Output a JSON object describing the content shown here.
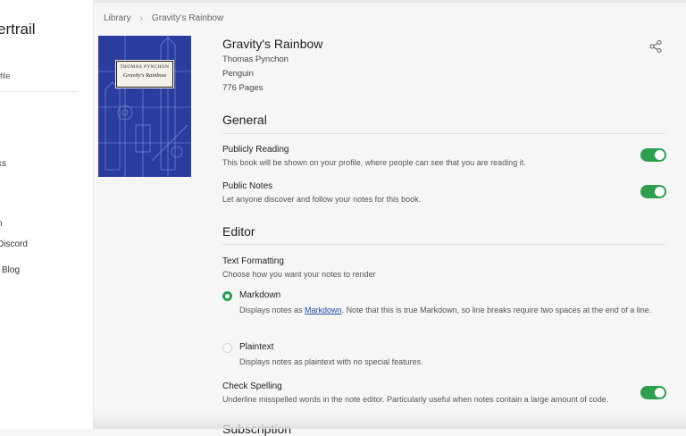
{
  "sidebar": {
    "brand": "ertrail",
    "profile": "file",
    "items": [
      {
        "label": "ks"
      },
      {
        "label": "n"
      },
      {
        "label": "Discord"
      },
      {
        "label": "l Blog"
      }
    ]
  },
  "breadcrumb": {
    "root": "Library",
    "separator": "›",
    "current": "Gravity's Rainbow"
  },
  "book": {
    "title": "Gravity's Rainbow",
    "author": "Thomas Pynchon",
    "publisher": "Penguin",
    "pages": "776 Pages",
    "cover_author": "Thomas Pynchon",
    "cover_title": "Gravity's Rainbow"
  },
  "general": {
    "heading": "General",
    "publicly_reading": {
      "title": "Publicly Reading",
      "desc": "This book will be shown on your profile, where people can see that you are reading it.",
      "enabled": true
    },
    "public_notes": {
      "title": "Public Notes",
      "desc": "Let anyone discover and follow your notes for this book.",
      "enabled": true
    }
  },
  "editor": {
    "heading": "Editor",
    "text_formatting": {
      "title": "Text Formatting",
      "desc": "Choose how you want your notes to render"
    },
    "markdown": {
      "title": "Markdown",
      "desc_before": "Displays notes as ",
      "link": "Markdown",
      "desc_after": ". Note that this is true Markdown, so line breaks require two spaces at the end of a line.",
      "selected": true
    },
    "plaintext": {
      "title": "Plaintext",
      "desc": "Displays notes as plaintext with no special features.",
      "selected": false
    },
    "check_spelling": {
      "title": "Check Spelling",
      "desc": "Underline misspelled words in the note editor. Particularly useful when notes contain a large amount of code.",
      "enabled": true
    }
  },
  "next_section": {
    "heading": "Subscription"
  },
  "colors": {
    "accent": "#2e9e4f",
    "cover": "#2a3d9f",
    "link": "#1f4aa8"
  },
  "icons": {
    "share": "share-icon"
  }
}
